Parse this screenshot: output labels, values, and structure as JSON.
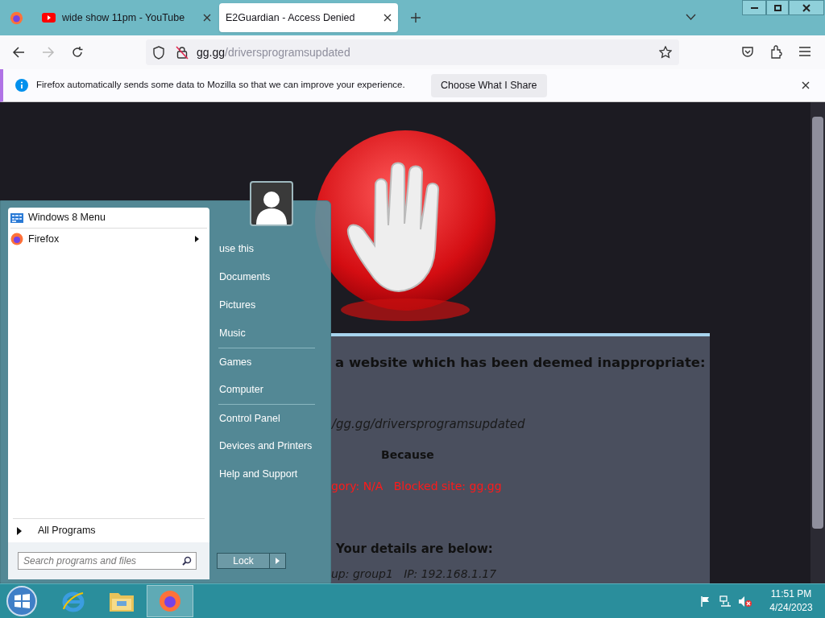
{
  "browser": {
    "tabs": [
      {
        "title": "wide show 11pm - YouTube",
        "kind": "youtube",
        "selected": false
      },
      {
        "title": "E2Guardian - Access Denied",
        "kind": "plain",
        "selected": true
      }
    ],
    "url_host": "gg.gg",
    "url_path": "/driversprogramsupdated",
    "notification": {
      "message": "Firefox automatically sends some data to Mozilla so that we can improve your experience.",
      "button": "Choose What I Share"
    }
  },
  "page": {
    "lines": [
      {
        "kind": "heading",
        "text": "a website which has been deemed inappropriate:"
      },
      {
        "kind": "url",
        "text": "/gg.gg/driversprogramsupdated"
      },
      {
        "kind": "label",
        "text": "Because"
      },
      {
        "kind": "reason",
        "text": "gory: N/A   Blocked site: gg.gg"
      },
      {
        "kind": "subheading",
        "text": "Your details are below:"
      },
      {
        "kind": "details",
        "text": "up: group1   IP: 192.168.1.17"
      }
    ]
  },
  "start_menu": {
    "programs": [
      {
        "label": "Windows 8 Menu",
        "kind": "tiles",
        "has_submenu": false
      },
      {
        "label": "Firefox",
        "kind": "firefox",
        "has_submenu": true
      }
    ],
    "all_programs": "All Programs",
    "search": {
      "placeholder": "Search programs and files"
    },
    "places": [
      {
        "label": "use this",
        "divider_before": false
      },
      {
        "label": "Documents",
        "divider_before": false
      },
      {
        "label": "Pictures",
        "divider_before": false
      },
      {
        "label": "Music",
        "divider_before": false
      },
      {
        "label": "Games",
        "divider_before": true
      },
      {
        "label": "Computer",
        "divider_before": false
      },
      {
        "label": "Control Panel",
        "divider_before": true
      },
      {
        "label": "Devices and Printers",
        "divider_before": false
      },
      {
        "label": "Help and Support",
        "divider_before": false
      }
    ],
    "lock_button": "Lock"
  },
  "taskbar": {
    "apps": [
      {
        "kind": "ie",
        "selected": false
      },
      {
        "kind": "explorer",
        "selected": false
      },
      {
        "kind": "firefox",
        "selected": true
      }
    ],
    "time": "11:51 PM",
    "date": "4/24/2023"
  }
}
